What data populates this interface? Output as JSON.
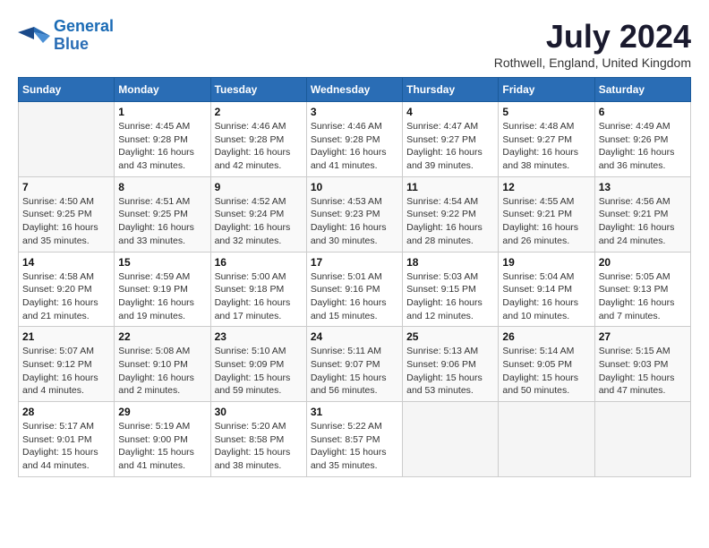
{
  "logo": {
    "line1": "General",
    "line2": "Blue"
  },
  "title": "July 2024",
  "location": "Rothwell, England, United Kingdom",
  "headers": [
    "Sunday",
    "Monday",
    "Tuesday",
    "Wednesday",
    "Thursday",
    "Friday",
    "Saturday"
  ],
  "weeks": [
    [
      {
        "day": "",
        "info": ""
      },
      {
        "day": "1",
        "info": "Sunrise: 4:45 AM\nSunset: 9:28 PM\nDaylight: 16 hours\nand 43 minutes."
      },
      {
        "day": "2",
        "info": "Sunrise: 4:46 AM\nSunset: 9:28 PM\nDaylight: 16 hours\nand 42 minutes."
      },
      {
        "day": "3",
        "info": "Sunrise: 4:46 AM\nSunset: 9:28 PM\nDaylight: 16 hours\nand 41 minutes."
      },
      {
        "day": "4",
        "info": "Sunrise: 4:47 AM\nSunset: 9:27 PM\nDaylight: 16 hours\nand 39 minutes."
      },
      {
        "day": "5",
        "info": "Sunrise: 4:48 AM\nSunset: 9:27 PM\nDaylight: 16 hours\nand 38 minutes."
      },
      {
        "day": "6",
        "info": "Sunrise: 4:49 AM\nSunset: 9:26 PM\nDaylight: 16 hours\nand 36 minutes."
      }
    ],
    [
      {
        "day": "7",
        "info": "Sunrise: 4:50 AM\nSunset: 9:25 PM\nDaylight: 16 hours\nand 35 minutes."
      },
      {
        "day": "8",
        "info": "Sunrise: 4:51 AM\nSunset: 9:25 PM\nDaylight: 16 hours\nand 33 minutes."
      },
      {
        "day": "9",
        "info": "Sunrise: 4:52 AM\nSunset: 9:24 PM\nDaylight: 16 hours\nand 32 minutes."
      },
      {
        "day": "10",
        "info": "Sunrise: 4:53 AM\nSunset: 9:23 PM\nDaylight: 16 hours\nand 30 minutes."
      },
      {
        "day": "11",
        "info": "Sunrise: 4:54 AM\nSunset: 9:22 PM\nDaylight: 16 hours\nand 28 minutes."
      },
      {
        "day": "12",
        "info": "Sunrise: 4:55 AM\nSunset: 9:21 PM\nDaylight: 16 hours\nand 26 minutes."
      },
      {
        "day": "13",
        "info": "Sunrise: 4:56 AM\nSunset: 9:21 PM\nDaylight: 16 hours\nand 24 minutes."
      }
    ],
    [
      {
        "day": "14",
        "info": "Sunrise: 4:58 AM\nSunset: 9:20 PM\nDaylight: 16 hours\nand 21 minutes."
      },
      {
        "day": "15",
        "info": "Sunrise: 4:59 AM\nSunset: 9:19 PM\nDaylight: 16 hours\nand 19 minutes."
      },
      {
        "day": "16",
        "info": "Sunrise: 5:00 AM\nSunset: 9:18 PM\nDaylight: 16 hours\nand 17 minutes."
      },
      {
        "day": "17",
        "info": "Sunrise: 5:01 AM\nSunset: 9:16 PM\nDaylight: 16 hours\nand 15 minutes."
      },
      {
        "day": "18",
        "info": "Sunrise: 5:03 AM\nSunset: 9:15 PM\nDaylight: 16 hours\nand 12 minutes."
      },
      {
        "day": "19",
        "info": "Sunrise: 5:04 AM\nSunset: 9:14 PM\nDaylight: 16 hours\nand 10 minutes."
      },
      {
        "day": "20",
        "info": "Sunrise: 5:05 AM\nSunset: 9:13 PM\nDaylight: 16 hours\nand 7 minutes."
      }
    ],
    [
      {
        "day": "21",
        "info": "Sunrise: 5:07 AM\nSunset: 9:12 PM\nDaylight: 16 hours\nand 4 minutes."
      },
      {
        "day": "22",
        "info": "Sunrise: 5:08 AM\nSunset: 9:10 PM\nDaylight: 16 hours\nand 2 minutes."
      },
      {
        "day": "23",
        "info": "Sunrise: 5:10 AM\nSunset: 9:09 PM\nDaylight: 15 hours\nand 59 minutes."
      },
      {
        "day": "24",
        "info": "Sunrise: 5:11 AM\nSunset: 9:07 PM\nDaylight: 15 hours\nand 56 minutes."
      },
      {
        "day": "25",
        "info": "Sunrise: 5:13 AM\nSunset: 9:06 PM\nDaylight: 15 hours\nand 53 minutes."
      },
      {
        "day": "26",
        "info": "Sunrise: 5:14 AM\nSunset: 9:05 PM\nDaylight: 15 hours\nand 50 minutes."
      },
      {
        "day": "27",
        "info": "Sunrise: 5:15 AM\nSunset: 9:03 PM\nDaylight: 15 hours\nand 47 minutes."
      }
    ],
    [
      {
        "day": "28",
        "info": "Sunrise: 5:17 AM\nSunset: 9:01 PM\nDaylight: 15 hours\nand 44 minutes."
      },
      {
        "day": "29",
        "info": "Sunrise: 5:19 AM\nSunset: 9:00 PM\nDaylight: 15 hours\nand 41 minutes."
      },
      {
        "day": "30",
        "info": "Sunrise: 5:20 AM\nSunset: 8:58 PM\nDaylight: 15 hours\nand 38 minutes."
      },
      {
        "day": "31",
        "info": "Sunrise: 5:22 AM\nSunset: 8:57 PM\nDaylight: 15 hours\nand 35 minutes."
      },
      {
        "day": "",
        "info": ""
      },
      {
        "day": "",
        "info": ""
      },
      {
        "day": "",
        "info": ""
      }
    ]
  ]
}
